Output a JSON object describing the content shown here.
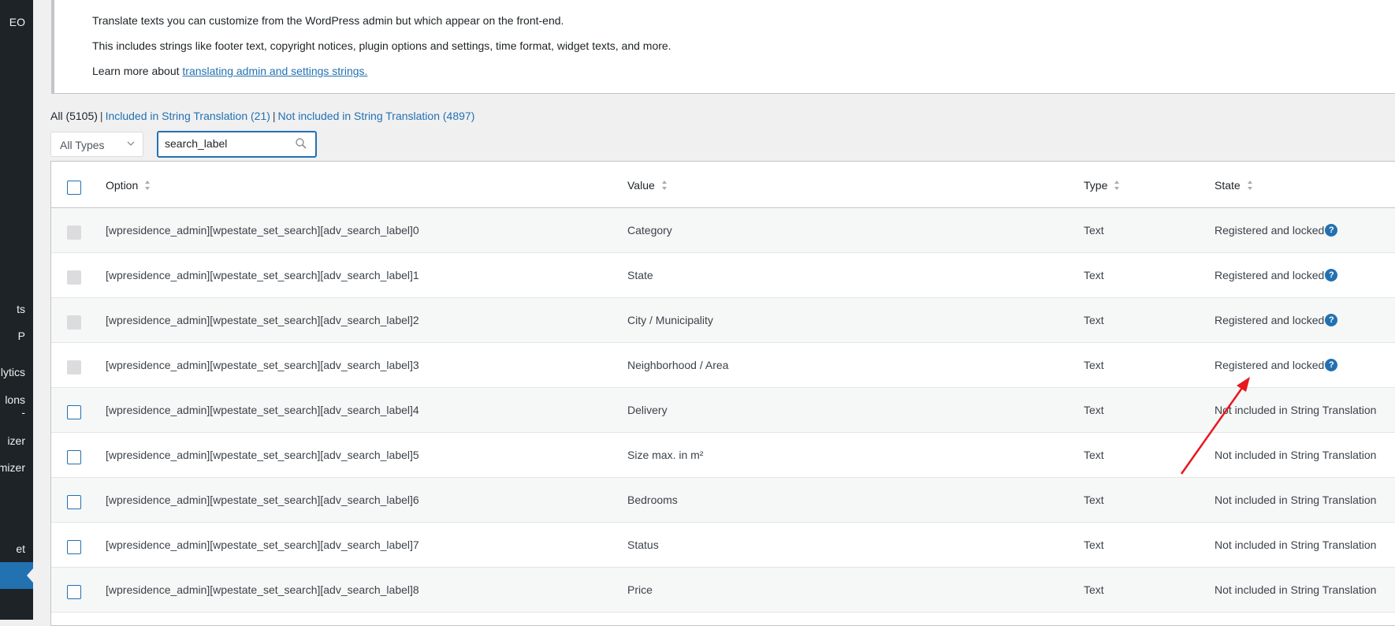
{
  "sidebar": {
    "items": [
      "EO",
      "ts",
      "P",
      "lytics",
      "lons",
      "izer",
      "mizer",
      "et"
    ]
  },
  "notice": {
    "line1": "Translate texts you can customize from the WordPress admin but which appear on the front-end.",
    "line2": "This includes strings like footer text, copyright notices, plugin options and settings, time format, widget texts, and more.",
    "line3_prefix": "Learn more about ",
    "line3_link": "translating admin and settings strings."
  },
  "filters": {
    "all": "All (5105)",
    "separator": "|",
    "included": "Included in String Translation (21)",
    "not_included": "Not included in String Translation (4897)"
  },
  "type_select": {
    "value": "All Types"
  },
  "search": {
    "value": "search_label"
  },
  "table": {
    "headers": {
      "option": "Option",
      "value": "Value",
      "type": "Type",
      "state": "State"
    },
    "help_glyph": "?",
    "rows": [
      {
        "option": "[wpresidence_admin][wpestate_set_search][adv_search_label]0",
        "value": "Category",
        "type": "Text",
        "state": "Registered and locked",
        "locked": true
      },
      {
        "option": "[wpresidence_admin][wpestate_set_search][adv_search_label]1",
        "value": "State",
        "type": "Text",
        "state": "Registered and locked",
        "locked": true
      },
      {
        "option": "[wpresidence_admin][wpestate_set_search][adv_search_label]2",
        "value": "City / Municipality",
        "type": "Text",
        "state": "Registered and locked",
        "locked": true
      },
      {
        "option": "[wpresidence_admin][wpestate_set_search][adv_search_label]3",
        "value": "Neighborhood / Area",
        "type": "Text",
        "state": "Registered and locked",
        "locked": true
      },
      {
        "option": "[wpresidence_admin][wpestate_set_search][adv_search_label]4",
        "value": "Delivery",
        "type": "Text",
        "state": "Not included in String Translation",
        "locked": false
      },
      {
        "option": "[wpresidence_admin][wpestate_set_search][adv_search_label]5",
        "value": "Size max. in m²",
        "type": "Text",
        "state": "Not included in String Translation",
        "locked": false
      },
      {
        "option": "[wpresidence_admin][wpestate_set_search][adv_search_label]6",
        "value": "Bedrooms",
        "type": "Text",
        "state": "Not included in String Translation",
        "locked": false
      },
      {
        "option": "[wpresidence_admin][wpestate_set_search][adv_search_label]7",
        "value": "Status",
        "type": "Text",
        "state": "Not included in String Translation",
        "locked": false
      },
      {
        "option": "[wpresidence_admin][wpestate_set_search][adv_search_label]8",
        "value": "Price",
        "type": "Text",
        "state": "Not included in String Translation",
        "locked": false
      }
    ]
  },
  "colors": {
    "accent": "#2271b1",
    "annotation_arrow": "#e8171d",
    "sidebar": "#1d2327"
  }
}
